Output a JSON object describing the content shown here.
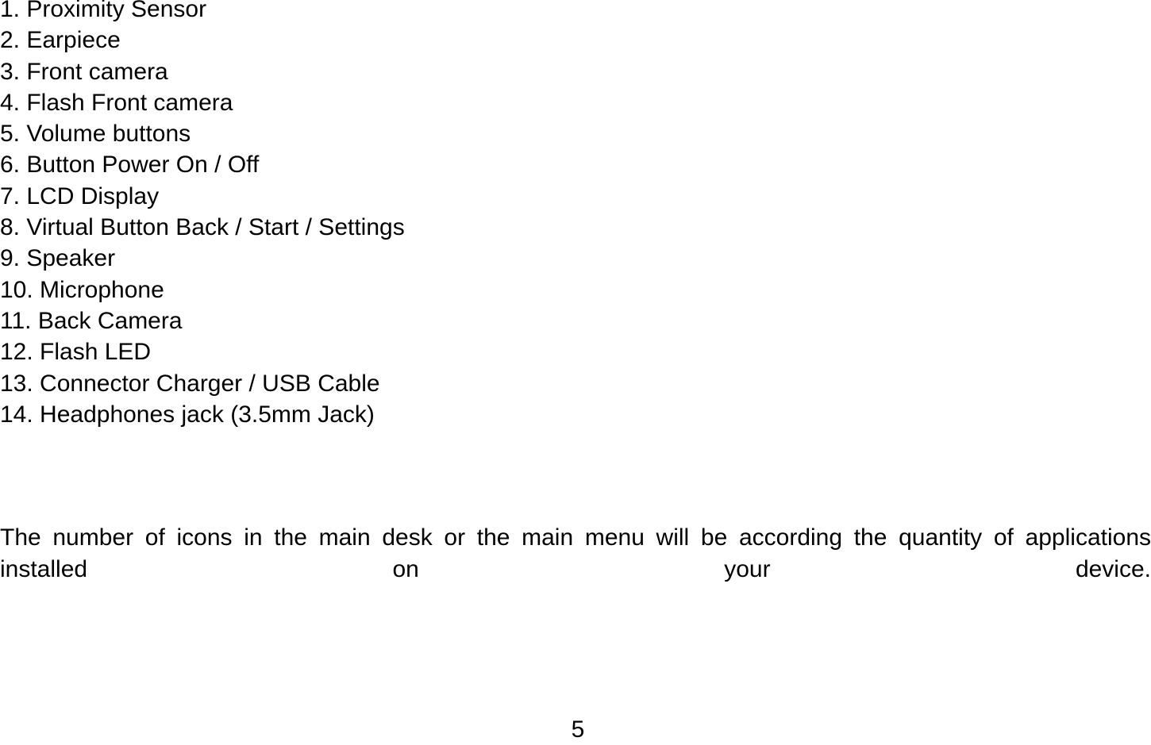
{
  "document": {
    "page_number": "5",
    "parts_list": [
      "1. Proximity Sensor",
      "2. Earpiece",
      "3. Front camera",
      "4. Flash Front camera",
      "5. Volume buttons",
      "6. Button Power On / Off",
      "7. LCD Display",
      "8. Virtual Button Back / Start / Settings",
      "9. Speaker",
      "10. Microphone",
      "11. Back Camera",
      "12. Flash LED",
      "13. Connector Charger / USB Cable",
      "14. Headphones jack (3.5mm Jack)"
    ],
    "paragraph": "The number of icons in the main desk or the main menu will be according the quantity of applications installed on your device.",
    "colors": {
      "text": "#000000",
      "background": "#ffffff"
    }
  }
}
